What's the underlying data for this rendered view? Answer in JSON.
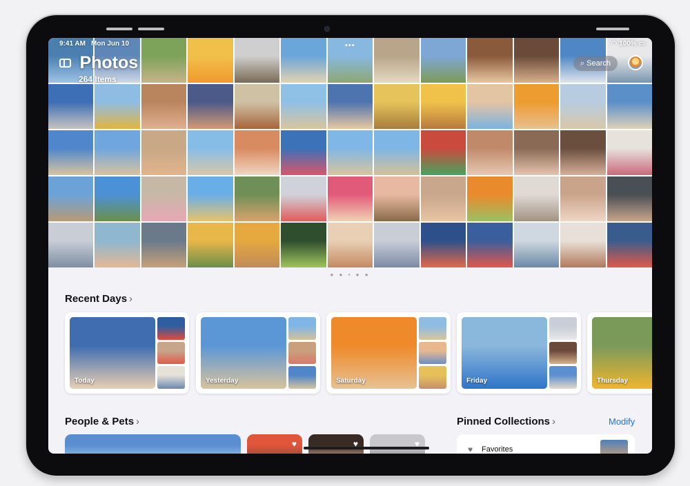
{
  "status_bar": {
    "time": "9:41 AM",
    "date": "Mon Jun 10",
    "battery": "100%"
  },
  "header": {
    "title": "Photos",
    "count": "264 Items",
    "search_label": "Search"
  },
  "grid": {
    "columns": 13,
    "photos": [
      [
        "#4a7fb0",
        "#9dc3e6"
      ],
      [
        "#5e87b8",
        "#cfd8e6"
      ],
      [
        "#7da35a",
        "#c7b389"
      ],
      [
        "#f0c04a",
        "#f29a2e"
      ],
      [
        "#cfcfcf",
        "#7a6a55"
      ],
      [
        "#6aa6d9",
        "#e2d2b0"
      ],
      [
        "#87b8e0",
        "#8fa873"
      ],
      [
        "#b9a58a",
        "#e5d8c2"
      ],
      [
        "#7ea7d6",
        "#7e9b56"
      ],
      [
        "#8a5a3c",
        "#e8c6a0"
      ],
      [
        "#6b4a3a",
        "#d9b08c"
      ],
      [
        "#4f86c4",
        "#dfe5ea"
      ],
      [
        "#e8e8ea",
        "#7a96b0"
      ],
      [
        "#3d6fb6",
        "#c7c4bf"
      ],
      [
        "#8fbce3",
        "#e3b542"
      ],
      [
        "#b9855f",
        "#e0b090"
      ],
      [
        "#4c5a8a",
        "#d49a73"
      ],
      [
        "#cfc1a4",
        "#a8653a"
      ],
      [
        "#8fc0e6",
        "#d9c59c"
      ],
      [
        "#4e74b0",
        "#e8c9a0"
      ],
      [
        "#e6c35b",
        "#a87c3e"
      ],
      [
        "#f0c24a",
        "#b7793f"
      ],
      [
        "#e3c4a3",
        "#7ab4e0"
      ],
      [
        "#ed9c2f",
        "#e8c091"
      ],
      [
        "#b7ccdf",
        "#d9c7a8"
      ],
      [
        "#5b8fc8",
        "#dfd2ba"
      ],
      [
        "#4f86cc",
        "#d8c49f"
      ],
      [
        "#6fa6de",
        "#d8c2a0"
      ],
      [
        "#c8a886",
        "#e2b48c"
      ],
      [
        "#86bde6",
        "#d9c7a8"
      ],
      [
        "#d88a60",
        "#f0d6c3"
      ],
      [
        "#3b72b8",
        "#d9566a"
      ],
      [
        "#7fb7e6",
        "#d9c59c"
      ],
      [
        "#7eb6e6",
        "#d6c097"
      ],
      [
        "#c94b3e",
        "#47a35e"
      ],
      [
        "#c08a6a",
        "#e8c8b2"
      ],
      [
        "#8a6a55",
        "#e6c4ae"
      ],
      [
        "#6a4e3e",
        "#d6b098"
      ],
      [
        "#e8e2dc",
        "#c86a7a"
      ],
      [
        "#6ba3d8",
        "#b79a76"
      ],
      [
        "#4c91d6",
        "#6b8f4a"
      ],
      [
        "#c7b8a6",
        "#e7a7b5"
      ],
      [
        "#6aaee8",
        "#e6c36a"
      ],
      [
        "#6f8f58",
        "#d9a26d"
      ],
      [
        "#cfd3d9",
        "#e25a5a"
      ],
      [
        "#e25a7a",
        "#f0d2b4"
      ],
      [
        "#e8b9a0",
        "#8a6a4a"
      ],
      [
        "#c9a78c",
        "#e8c4a2"
      ],
      [
        "#e98a2c",
        "#9cc064"
      ],
      [
        "#e0dad4",
        "#a39382"
      ],
      [
        "#caa48a",
        "#f0d6c6"
      ],
      [
        "#4a4e55",
        "#c7a58a"
      ],
      [
        "#c8cdd6",
        "#7e8fa3"
      ],
      [
        "#8fb7d0",
        "#e3b893"
      ],
      [
        "#6a7a8a",
        "#c7a078"
      ],
      [
        "#e8b74a",
        "#6a8f4a"
      ],
      [
        "#e6a940",
        "#c08a5a"
      ],
      [
        "#2e4e2e",
        "#9fc55a"
      ],
      [
        "#e9d0b4",
        "#c48a62"
      ],
      [
        "#c9cdd6",
        "#7c8aa6"
      ],
      [
        "#2d4f8a",
        "#e26a4a"
      ],
      [
        "#3a5f9c",
        "#e2574c"
      ],
      [
        "#cfd8e0",
        "#6a88a8"
      ],
      [
        "#e8e0d8",
        "#b07a5a"
      ],
      [
        "#3a5c8c",
        "#e05a4a"
      ]
    ]
  },
  "recent_days": {
    "title": "Recent Days",
    "cards": [
      {
        "label": "Today",
        "main": [
          "#3f6db0",
          "#e8cfb3"
        ],
        "thumbs": [
          [
            "#2f5ea0",
            "#e24a3a"
          ],
          [
            "#c7a58a",
            "#e05a4a"
          ],
          [
            "#e6e2d8",
            "#6a88b0"
          ]
        ]
      },
      {
        "label": "Yesterday",
        "main": [
          "#5b97d6",
          "#d7c39c"
        ],
        "thumbs": [
          [
            "#7fb6e6",
            "#d6c097"
          ],
          [
            "#c8a07e",
            "#d97a6a"
          ],
          [
            "#4f86c8",
            "#d6c49e"
          ]
        ]
      },
      {
        "label": "Saturday",
        "main": [
          "#ee8a2a",
          "#e7c293"
        ],
        "thumbs": [
          [
            "#8fbce3",
            "#d9c59c"
          ],
          [
            "#e8b98f",
            "#6a8fc8"
          ],
          [
            "#e6c15a",
            "#c78f6a"
          ]
        ]
      },
      {
        "label": "Friday",
        "main": [
          "#8ab7dc",
          "#2f74c8"
        ],
        "thumbs": [
          [
            "#c8cfd8",
            "#e8e8e8"
          ],
          [
            "#6b4a3a",
            "#d9b08c"
          ],
          [
            "#5a8fd0",
            "#e6d9c7"
          ]
        ]
      },
      {
        "label": "Thursday",
        "main": [
          "#7a9a5a",
          "#f0b62e"
        ],
        "thumbs": []
      }
    ]
  },
  "people": {
    "title": "People & Pets",
    "cards": [
      {
        "colors": [
          "#5a8ed0",
          "#a8cce8"
        ]
      },
      {
        "colors": [
          "#e0563a",
          "#7a4a3a"
        ]
      },
      {
        "colors": [
          "#3a2a24",
          "#e5b8a0"
        ]
      },
      {
        "colors": [
          "#c8c8cc",
          "#8a8a90"
        ]
      }
    ]
  },
  "pinned": {
    "title": "Pinned Collections",
    "modify_label": "Modify",
    "favorites_label": "Favorites"
  },
  "colors": {
    "accent": "#1a74e8",
    "bezel": "#0c0c0e",
    "background": "#f2f2f7"
  }
}
